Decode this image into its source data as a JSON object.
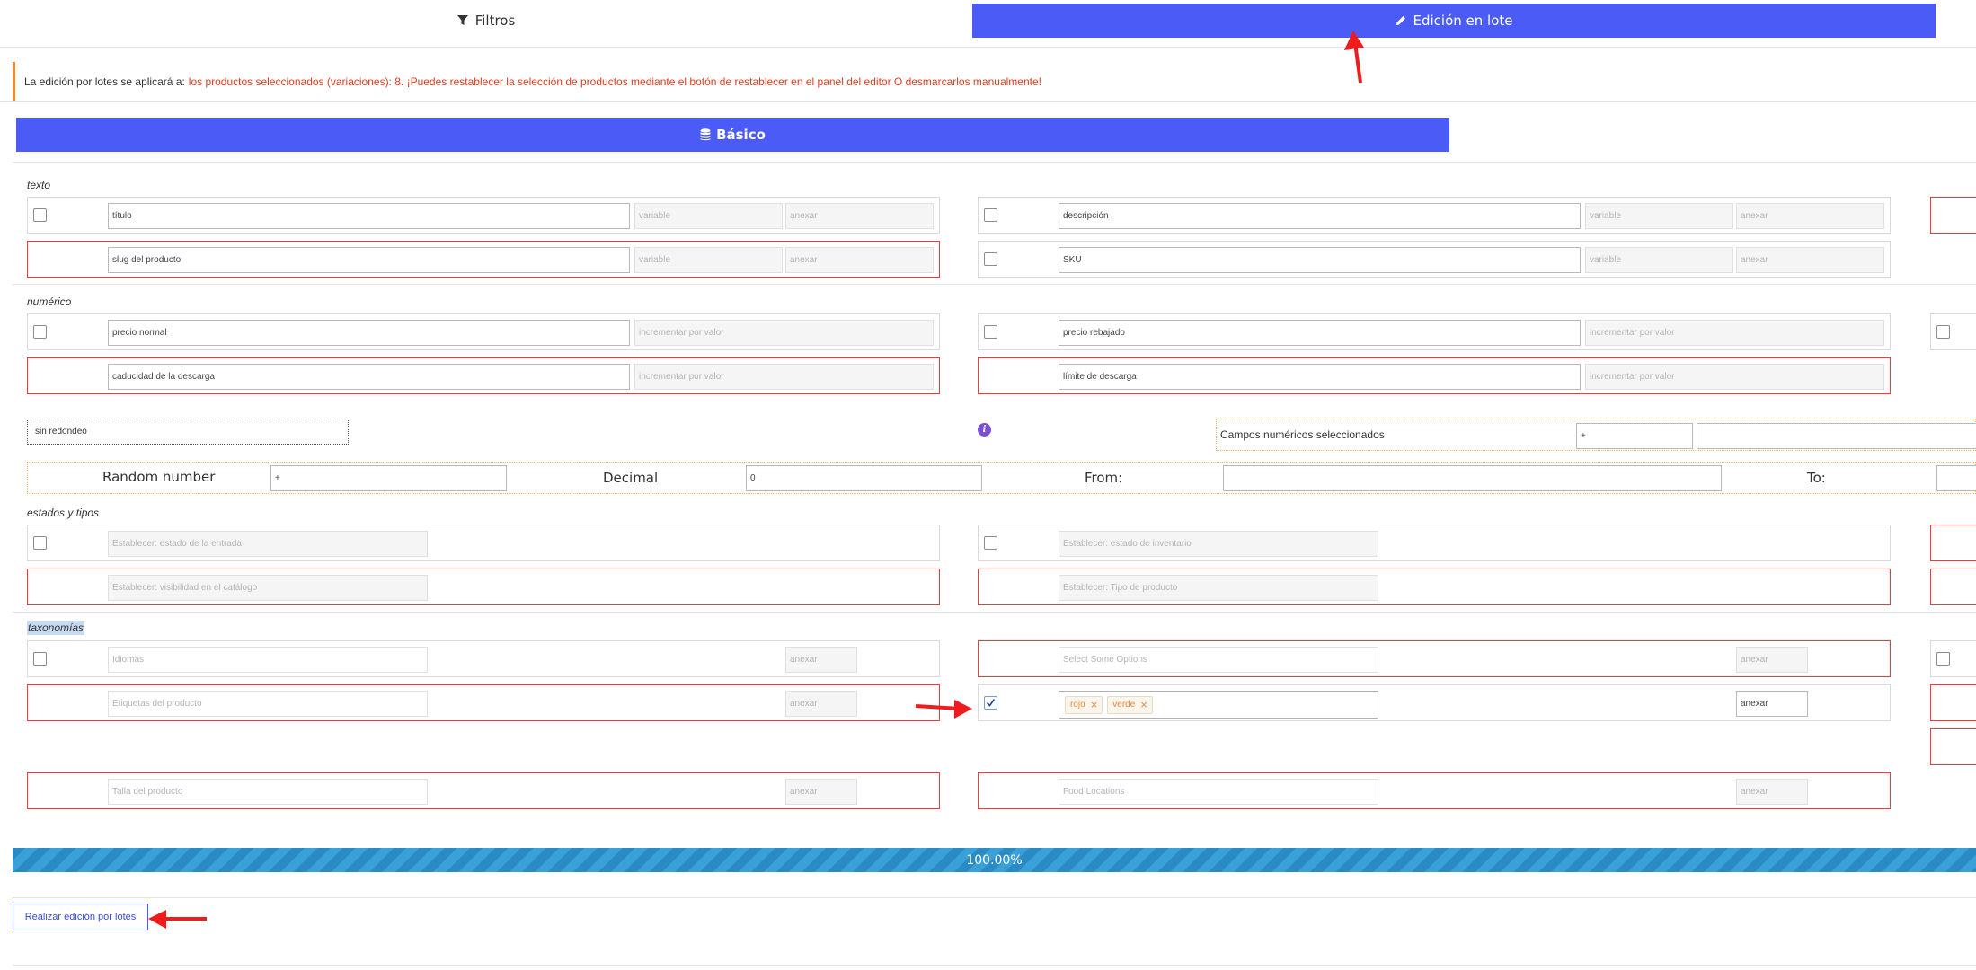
{
  "tabs": {
    "filters_label": "Filtros",
    "batch_label": "Edición en lote"
  },
  "notice": {
    "prefix": "La edición por lotes se aplicará a:",
    "message": "los productos seleccionados (variaciones): 8. ¡Puedes restablecer la selección de productos mediante el botón de restablecer en el panel del editor O desmarcarlos manualmente!"
  },
  "basic_button": "Básico",
  "sections": {
    "text": "texto",
    "numeric": "numérico",
    "states": "estados y tipos",
    "taxonomies": "taxonomías"
  },
  "text_fields": {
    "title": "título",
    "description": "descripción",
    "slug": "slug del producto",
    "sku": "SKU",
    "variable_placeholder": "variable",
    "append_placeholder": "anexar"
  },
  "numeric_fields": {
    "regular_price": "precio normal",
    "sale_price": "precio rebajado",
    "download_expiry": "caducidad de la descarga",
    "download_limit": "límite de descarga",
    "increment_placeholder": "incrementar por valor",
    "rounding": "sin redondeo",
    "selected_numeric_fields": "Campos numéricos seleccionados",
    "operator": "+"
  },
  "random": {
    "label": "Random number",
    "operator": "+",
    "decimal_label": "Decimal",
    "decimal_value": "0",
    "from_label": "From:",
    "to_label": "To:"
  },
  "state_fields": {
    "post_status": "Establecer: estado de la entrada",
    "stock_status": "Establecer: estado de inventario",
    "catalog_visibility": "Establecer: visibilidad en el catálogo",
    "product_type": "Establecer: Tipo de producto"
  },
  "taxonomy_fields": {
    "languages": "Idiomas",
    "select_options": "Select Some Options",
    "product_tags": "Etiquetas del producto",
    "product_size": "Talla del producto",
    "food_locations": "Food Locations",
    "append": "anexar",
    "append_active": "anexar",
    "tags": [
      "rojo",
      "verde"
    ],
    "tag_remove": "×"
  },
  "progress": {
    "label": "100.00%",
    "value": 100
  },
  "action_button": "Realizar edición por lotes",
  "colors": {
    "primary": "#4a5cf5",
    "error_border": "#f23a3a",
    "warning": "#e53a1c",
    "progress": "#2a8bc4",
    "arrow": "#ee1c1c"
  }
}
